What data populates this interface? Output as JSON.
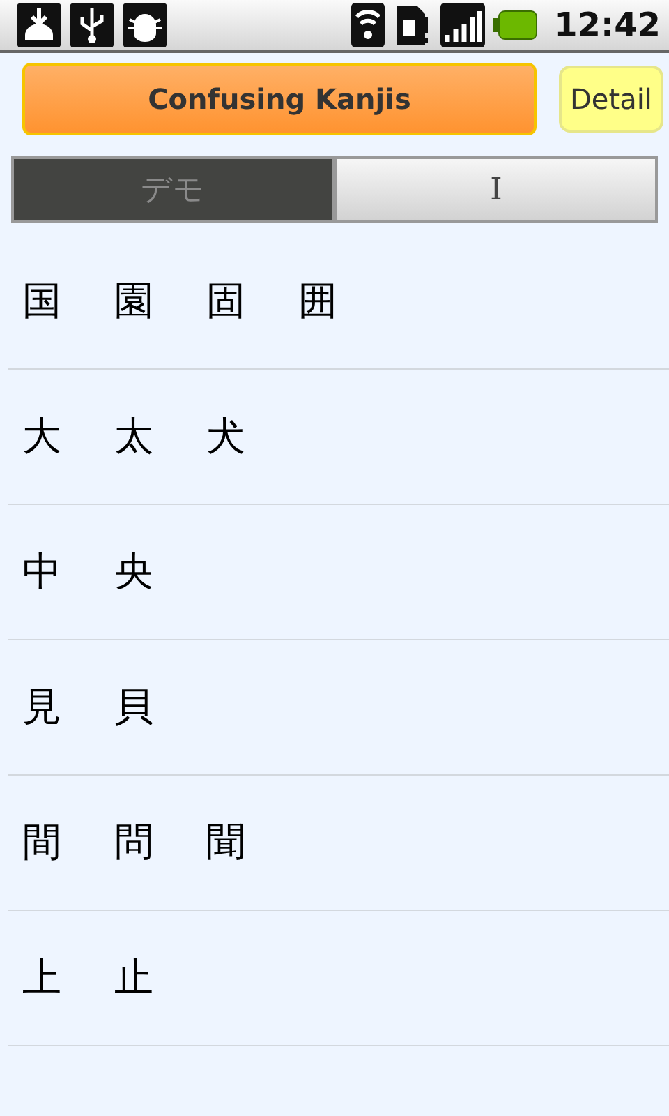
{
  "status_bar": {
    "time": "12:42"
  },
  "header": {
    "title": "Confusing Kanjis",
    "detail_button": "Detail"
  },
  "tabs": [
    {
      "label": "デモ",
      "selected": true
    },
    {
      "label": "I",
      "selected": false
    }
  ],
  "rows": [
    {
      "kanjis": [
        "国",
        "園",
        "固",
        "囲"
      ]
    },
    {
      "kanjis": [
        "大",
        "太",
        "犬"
      ]
    },
    {
      "kanjis": [
        "中",
        "央"
      ]
    },
    {
      "kanjis": [
        "見",
        "貝"
      ]
    },
    {
      "kanjis": [
        "間",
        "問",
        "聞"
      ]
    },
    {
      "kanjis": [
        "上",
        "止"
      ]
    }
  ]
}
